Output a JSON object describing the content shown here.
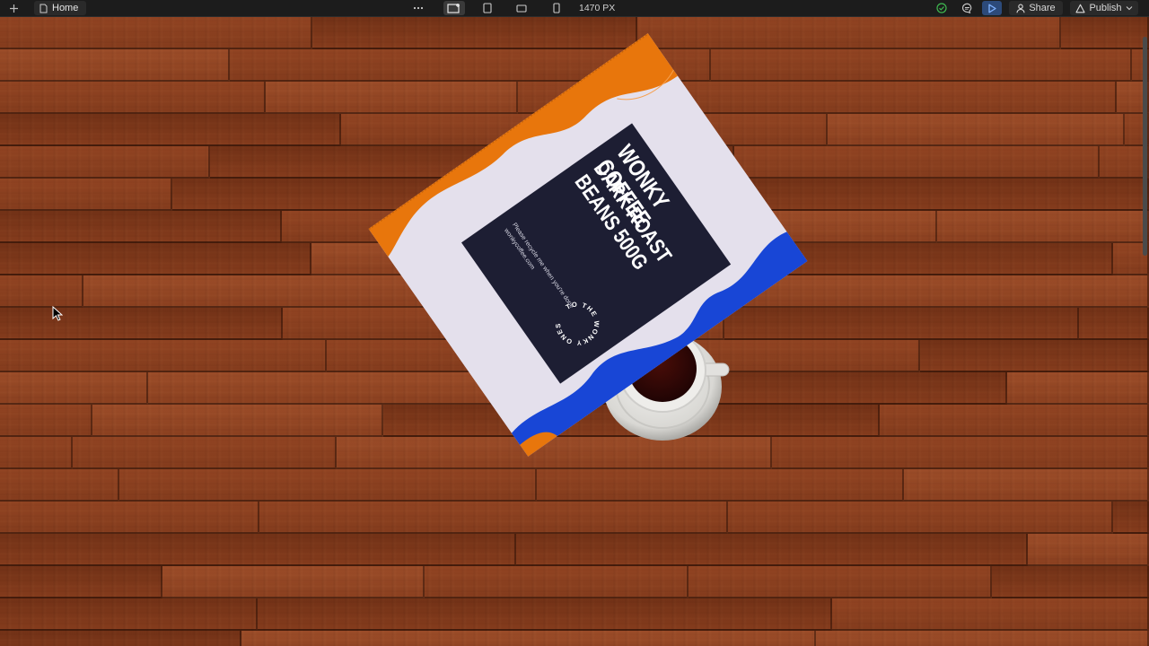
{
  "toolbar": {
    "page_tab": "Home",
    "width_readout": "1470 PX",
    "share_label": "Share",
    "publish_label": "Publish",
    "icons": [
      "insert-icon",
      "page-icon",
      "more-icon",
      "desktop-breakpoint-icon",
      "tablet-breakpoint-icon",
      "tablet-landscape-icon",
      "mobile-breakpoint-icon",
      "check-circle-icon",
      "comment-icon",
      "play-icon",
      "user-icon",
      "chevron-down-icon"
    ],
    "colors": {
      "bar": "#1c1c1c",
      "check": "#3fb950",
      "play": "#2c4a7a"
    }
  },
  "canvas": {
    "background": "wood floor",
    "bag": {
      "brand": "WONKY COFFEE",
      "product": "DARK ROAST\nBEANS 500G",
      "recycle_note": "Please recycle me when you're done",
      "website": "wonkycoffee.com",
      "seal_text": "TO THE WONKY ONES",
      "colors": {
        "label": "#1d1e33",
        "bag": "#e4e0ec",
        "orange": "#e8760c",
        "blue": "#1846d6"
      }
    },
    "cup": {
      "colors": {
        "coffee": "#3a0a06",
        "porcelain": "#ecebe8"
      }
    }
  }
}
